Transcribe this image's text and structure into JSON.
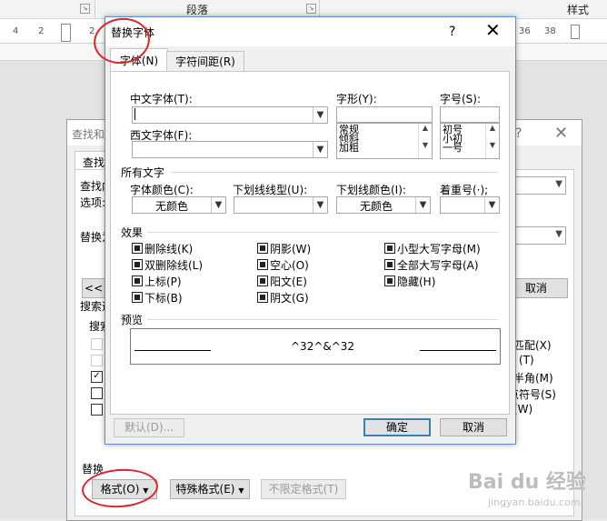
{
  "ribbon": {
    "paragraph_label": "段落",
    "styles_label": "样式"
  },
  "ruler": {
    "marks": [
      "4",
      "2",
      "2",
      "36",
      "38"
    ]
  },
  "find_dialog": {
    "title": "查找和替",
    "tab_label": "查找(",
    "row_labels": [
      "查找内",
      "选项:",
      "替换为"
    ],
    "more_button": "<< 更",
    "cancel_button": "取消",
    "search_options_label": "搜索选",
    "search_label": "搜索",
    "right_options": [
      "匹配(X)",
      "(T)",
      "半角(M)",
      "点符号(S)",
      "(W)"
    ],
    "replace_section": "替换",
    "format_button": "格式(O)",
    "special_button": "特殊格式(E)",
    "no_format_button": "不限定格式(T)",
    "help_glyph": "?",
    "close_glyph": "✕"
  },
  "font_dialog": {
    "title": "替换字体",
    "help_glyph": "?",
    "close_glyph": "✕",
    "tabs": [
      {
        "label": "字体(N)",
        "active": true
      },
      {
        "label": "字符间距(R)",
        "active": false
      }
    ],
    "chinese_font_label": "中文字体(T):",
    "chinese_font_value": "",
    "western_font_label": "西文字体(F):",
    "western_font_value": "",
    "style_label": "字形(Y):",
    "style_value": "",
    "style_options": [
      "常规",
      "倾斜",
      "加粗"
    ],
    "size_label": "字号(S):",
    "size_value": "",
    "size_options": [
      "初号",
      "小初",
      "一号"
    ],
    "all_text_section": "所有文字",
    "font_color_label": "字体颜色(C):",
    "font_color_value": "无颜色",
    "underline_style_label": "下划线线型(U):",
    "underline_style_value": "",
    "underline_color_label": "下划线颜色(I):",
    "underline_color_value": "无颜色",
    "emphasis_label": "着重号(·);",
    "emphasis_value": "",
    "effects_section": "效果",
    "effects": [
      {
        "label": "删除线(K)",
        "checked": true
      },
      {
        "label": "双删除线(L)",
        "checked": true
      },
      {
        "label": "上标(P)",
        "checked": true
      },
      {
        "label": "下标(B)",
        "checked": true
      },
      {
        "label": "阴影(W)",
        "checked": true
      },
      {
        "label": "空心(O)",
        "checked": true
      },
      {
        "label": "阳文(E)",
        "checked": true
      },
      {
        "label": "阴文(G)",
        "checked": true
      },
      {
        "label": "小型大写字母(M)",
        "checked": true
      },
      {
        "label": "全部大写字母(A)",
        "checked": true
      },
      {
        "label": "隐藏(H)",
        "checked": true
      }
    ],
    "preview_section": "预览",
    "preview_text": "^32^&^32",
    "default_button": "默认(D)...",
    "ok_button": "确定",
    "cancel_button": "取消"
  },
  "watermark": {
    "brand": "Bai du 经验",
    "url": "jingyan.baidu.com"
  },
  "colors": {
    "annotation_red": "#e0242b",
    "dialog_border_blue": "#5a8dd6",
    "ok_border_blue": "#3c7fb1"
  }
}
